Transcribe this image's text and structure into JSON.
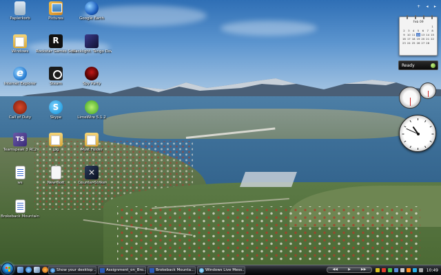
{
  "desktop": {
    "icons": [
      {
        "label": "Papierkorb",
        "icon": "recycle-bin-icon"
      },
      {
        "label": "Pictures",
        "icon": "pictures-icon"
      },
      {
        "label": "Google Earth",
        "icon": "google-earth-icon"
      },
      {
        "label": "Windows",
        "icon": "folder-icon"
      },
      {
        "label": "Rockstar Games Social Club",
        "icon": "rockstar-icon"
      },
      {
        "label": "Blacklight: Tango Down",
        "icon": "game-icon"
      },
      {
        "label": "Internet Explorer",
        "icon": "internet-explorer-icon"
      },
      {
        "label": "Steam",
        "icon": "steam-icon"
      },
      {
        "label": "Spy Party",
        "icon": "game-icon"
      },
      {
        "label": "Call of Duty",
        "icon": "game-icon"
      },
      {
        "label": "Skype",
        "icon": "skype-icon"
      },
      {
        "label": "LimeWire 5.1.2",
        "icon": "limewire-icon"
      },
      {
        "label": "Teamspeak 3 RC2",
        "icon": "teamspeak-icon"
      },
      {
        "label": "jpg",
        "icon": "folder-icon"
      },
      {
        "label": "Myst Folder",
        "icon": "folder-icon"
      },
      {
        "label": "ws",
        "icon": "document-icon"
      },
      {
        "label": "New Text",
        "icon": "text-file-icon"
      },
      {
        "label": "Counter-Strike",
        "icon": "counter-strike-icon"
      },
      {
        "label": "Brokeback Mountain",
        "icon": "document-icon"
      }
    ]
  },
  "sidebar": {
    "controls": [
      "+",
      "◂",
      "▸"
    ],
    "calendar": {
      "month": "Feb 09",
      "days": [
        "",
        "",
        "",
        "",
        "",
        "",
        "1",
        "2",
        "3",
        "4",
        "5",
        "6",
        "7",
        "8",
        "9",
        "10",
        "11",
        "12",
        "13",
        "14",
        "15",
        "16",
        "17",
        "18",
        "19",
        "20",
        "21",
        "22",
        "23",
        "24",
        "25",
        "26",
        "27",
        "28",
        ""
      ],
      "today": "12"
    },
    "status": {
      "label": "Ready"
    },
    "clock": {
      "hour": 10,
      "minute": 49
    }
  },
  "taskbar": {
    "quicklaunch": [
      "show-desktop-icon",
      "internet-explorer-icon",
      "flip-3d-icon",
      "media-player-icon"
    ],
    "tasks": [
      {
        "label": "Show your desktop ...",
        "icon": "internet-explorer-icon",
        "cls": "tb-i-ie"
      },
      {
        "label": "Assignment_on_Bro...",
        "icon": "word-document-icon",
        "cls": "tb-i-word"
      },
      {
        "label": "Brokeback Mounta...",
        "icon": "word-document-icon",
        "cls": "tb-i-word"
      },
      {
        "label": "Windows Live Mess...",
        "icon": "messenger-icon",
        "cls": "tb-i-msn"
      }
    ],
    "media_controls": [
      "◀◀",
      "▶",
      "▶▶"
    ],
    "tray_clock": "10:49"
  },
  "colors": {
    "accent": "#2b8fd8",
    "taskbar": "#14161a"
  }
}
